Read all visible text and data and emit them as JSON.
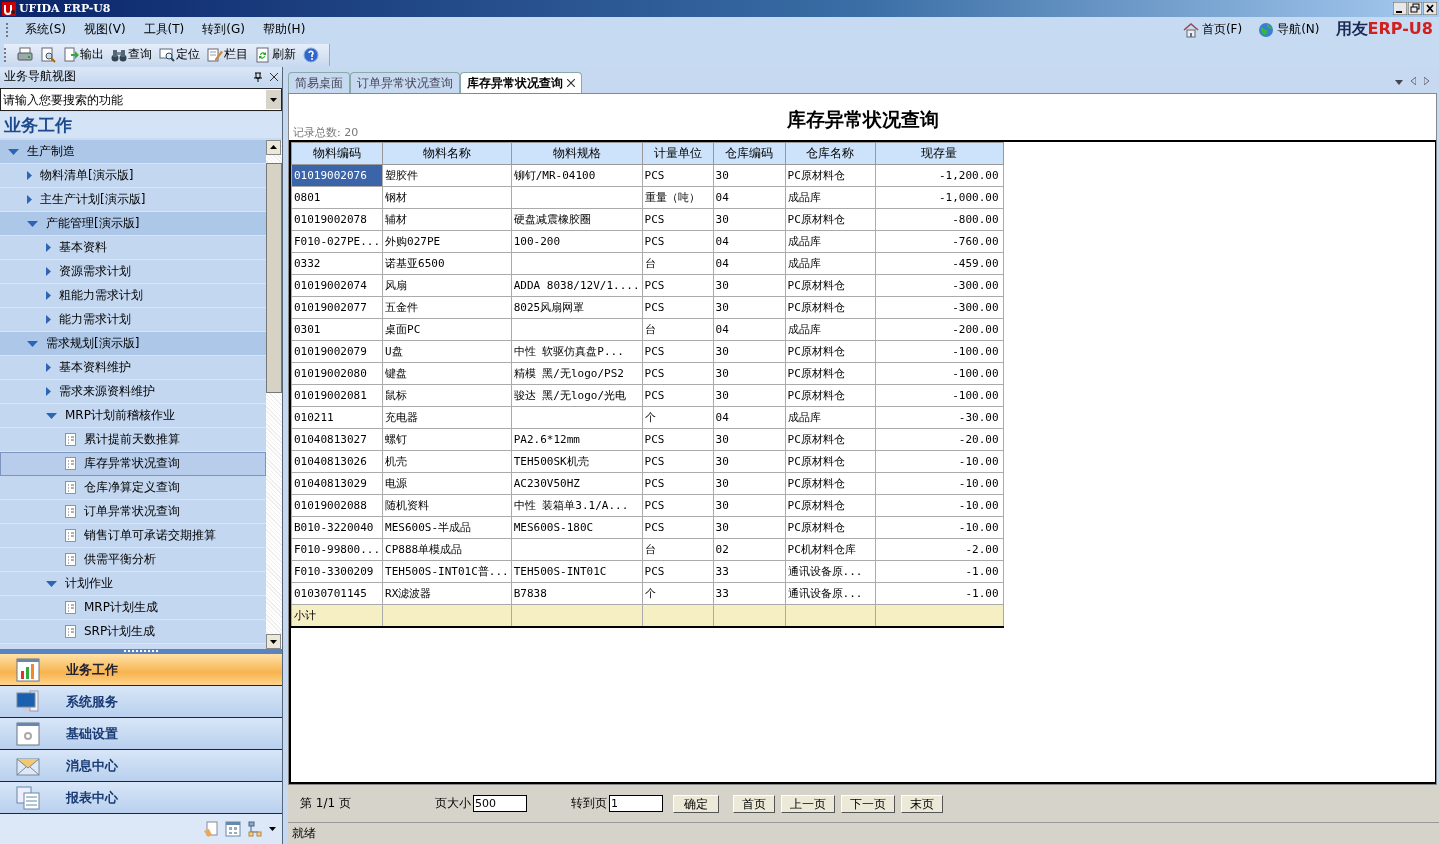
{
  "window": {
    "title": "UFIDA ERP-U8"
  },
  "menu": [
    "系统(S)",
    "视图(V)",
    "工具(T)",
    "转到(G)",
    "帮助(H)"
  ],
  "toolbar": [
    {
      "kind": "print"
    },
    {
      "kind": "preview"
    },
    {
      "kind": "export",
      "label": "输出"
    },
    {
      "kind": "query",
      "label": "查询"
    },
    {
      "kind": "locate",
      "label": "定位"
    },
    {
      "kind": "columns",
      "label": "栏目"
    },
    {
      "kind": "refresh",
      "label": "刷新"
    },
    {
      "kind": "help"
    }
  ],
  "top_links": [
    {
      "kind": "home",
      "label": "首页(F)"
    },
    {
      "kind": "globe",
      "label": "导航(N)"
    }
  ],
  "logo": {
    "name": "用友",
    "product": "ERP-U8"
  },
  "sidebar": {
    "title": "业务导航视图",
    "search": {
      "placeholder": "请输入您要搜索的功能"
    },
    "section": "业务工作",
    "tree": [
      {
        "label": "生产制造",
        "kind": "folder",
        "expanded": true,
        "selected": false,
        "children": [
          {
            "label": "物料清单[演示版]",
            "kind": "folder",
            "expanded": false,
            "selected": false
          },
          {
            "label": "主生产计划[演示版]",
            "kind": "folder",
            "expanded": false,
            "selected": false
          },
          {
            "label": "产能管理[演示版]",
            "kind": "folder",
            "expanded": true,
            "selected": false,
            "children": [
              {
                "label": "基本资料",
                "kind": "folder",
                "expanded": false,
                "selected": false
              },
              {
                "label": "资源需求计划",
                "kind": "folder",
                "expanded": false,
                "selected": false
              },
              {
                "label": "粗能力需求计划",
                "kind": "folder",
                "expanded": false,
                "selected": false
              },
              {
                "label": "能力需求计划",
                "kind": "folder",
                "expanded": false,
                "selected": false
              }
            ]
          },
          {
            "label": "需求规划[演示版]",
            "kind": "folder",
            "expanded": true,
            "selected": false,
            "children": [
              {
                "label": "基本资料维护",
                "kind": "folder",
                "expanded": false,
                "selected": false
              },
              {
                "label": "需求来源资料维护",
                "kind": "folder",
                "expanded": false,
                "selected": false
              },
              {
                "label": "MRP计划前稽核作业",
                "kind": "folder",
                "expanded": true,
                "selected": false,
                "children": [
                  {
                    "label": "累计提前天数推算",
                    "kind": "leaf",
                    "selected": false
                  },
                  {
                    "label": "库存异常状况查询",
                    "kind": "leaf",
                    "selected": true
                  },
                  {
                    "label": "仓库净算定义查询",
                    "kind": "leaf",
                    "selected": false
                  },
                  {
                    "label": "订单异常状况查询",
                    "kind": "leaf",
                    "selected": false
                  },
                  {
                    "label": "销售订单可承诺交期推算",
                    "kind": "leaf",
                    "selected": false
                  },
                  {
                    "label": "供需平衡分析",
                    "kind": "leaf",
                    "selected": false
                  }
                ]
              },
              {
                "label": "计划作业",
                "kind": "folder",
                "expanded": true,
                "selected": false,
                "children": [
                  {
                    "label": "MRP计划生成",
                    "kind": "leaf",
                    "selected": false
                  },
                  {
                    "label": "SRP计划生成",
                    "kind": "leaf",
                    "selected": false
                  }
                ]
              }
            ]
          }
        ]
      }
    ],
    "nav_buttons": [
      {
        "kind": "chart",
        "label": "业务工作",
        "selected": true
      },
      {
        "kind": "monitor",
        "label": "系统服务",
        "selected": false
      },
      {
        "kind": "gear",
        "label": "基础设置",
        "selected": false
      },
      {
        "kind": "mail",
        "label": "消息中心",
        "selected": false
      },
      {
        "kind": "report",
        "label": "报表中心",
        "selected": false
      }
    ]
  },
  "tabs": [
    {
      "label": "简易桌面",
      "selected": false
    },
    {
      "label": "订单异常状况查询",
      "selected": false
    },
    {
      "label": "库存异常状况查询",
      "selected": true,
      "closable": true
    }
  ],
  "report": {
    "title": "库存异常状况查询",
    "record_count": "记录总数: 20",
    "table": {
      "columns": [
        "物料编码",
        "物料名称",
        "物料规格",
        "计量单位",
        "仓库编码",
        "仓库名称",
        "现存量"
      ],
      "rows": [
        {
          "selected": true,
          "cells": [
            "01019002076",
            "塑胶件",
            "铆钉/MR-04100",
            "PCS",
            "30",
            "PC原材料仓",
            "-1,200.00"
          ]
        },
        {
          "selected": false,
          "cells": [
            "0801",
            "钢材",
            "",
            "重量（吨）",
            "04",
            "成品库",
            "-1,000.00"
          ]
        },
        {
          "selected": false,
          "cells": [
            "01019002078",
            "辅材",
            "硬盘减震橡胶圈",
            "PCS",
            "30",
            "PC原材料仓",
            "-800.00"
          ]
        },
        {
          "selected": false,
          "cells": [
            "F010-027PE...",
            "外购027PE",
            "100-200",
            "PCS",
            "04",
            "成品库",
            "-760.00"
          ]
        },
        {
          "selected": false,
          "cells": [
            "0332",
            "诺基亚6500",
            "",
            "台",
            "04",
            "成品库",
            "-459.00"
          ]
        },
        {
          "selected": false,
          "cells": [
            "01019002074",
            "风扇",
            "ADDA 8038/12V/1....",
            "PCS",
            "30",
            "PC原材料仓",
            "-300.00"
          ]
        },
        {
          "selected": false,
          "cells": [
            "01019002077",
            "五金件",
            "8025风扇网罩",
            "PCS",
            "30",
            "PC原材料仓",
            "-300.00"
          ]
        },
        {
          "selected": false,
          "cells": [
            "0301",
            "桌面PC",
            "",
            "台",
            "04",
            "成品库",
            "-200.00"
          ]
        },
        {
          "selected": false,
          "cells": [
            "01019002079",
            "U盘",
            "中性 软驱仿真盘P...",
            "PCS",
            "30",
            "PC原材料仓",
            "-100.00"
          ]
        },
        {
          "selected": false,
          "cells": [
            "01019002080",
            "键盘",
            "精模 黑/无logo/PS2",
            "PCS",
            "30",
            "PC原材料仓",
            "-100.00"
          ]
        },
        {
          "selected": false,
          "cells": [
            "01019002081",
            "鼠标",
            "骏达 黑/无logo/光电",
            "PCS",
            "30",
            "PC原材料仓",
            "-100.00"
          ]
        },
        {
          "selected": false,
          "cells": [
            "010211",
            "充电器",
            "",
            "个",
            "04",
            "成品库",
            "-30.00"
          ]
        },
        {
          "selected": false,
          "cells": [
            "01040813027",
            "螺钉",
            "PA2.6*12mm",
            "PCS",
            "30",
            "PC原材料仓",
            "-20.00"
          ]
        },
        {
          "selected": false,
          "cells": [
            "01040813026",
            "机壳",
            "TEH500SK机壳",
            "PCS",
            "30",
            "PC原材料仓",
            "-10.00"
          ]
        },
        {
          "selected": false,
          "cells": [
            "01040813029",
            "电源",
            "AC230V50HZ",
            "PCS",
            "30",
            "PC原材料仓",
            "-10.00"
          ]
        },
        {
          "selected": false,
          "cells": [
            "01019002088",
            "随机资料",
            "中性 装箱单3.1/A...",
            "PCS",
            "30",
            "PC原材料仓",
            "-10.00"
          ]
        },
        {
          "selected": false,
          "cells": [
            "B010-3220040",
            "MES600S-半成品",
            "MES600S-180C",
            "PCS",
            "30",
            "PC原材料仓",
            "-10.00"
          ]
        },
        {
          "selected": false,
          "cells": [
            "F010-99800...",
            "CP888单模成品",
            "",
            "台",
            "02",
            "PC机材料仓库",
            "-2.00"
          ]
        },
        {
          "selected": false,
          "cells": [
            "F010-3300209",
            "TEH500S-INT01C普...",
            "TEH500S-INT01C",
            "PCS",
            "33",
            "通讯设备原...",
            "-1.00"
          ]
        },
        {
          "selected": false,
          "cells": [
            "01030701145",
            "RX滤波器",
            "B7838",
            "个",
            "33",
            "通讯设备原...",
            "-1.00"
          ]
        }
      ],
      "subtotal": "小计"
    }
  },
  "pager": {
    "page": "第 1/1 页",
    "size_label": "页大小",
    "size": "500",
    "goto_label": "转到页",
    "goto": "1",
    "buttons": [
      "确定",
      "首页",
      "上一页",
      "下一页",
      "末页"
    ]
  },
  "status_bar": "就绪"
}
